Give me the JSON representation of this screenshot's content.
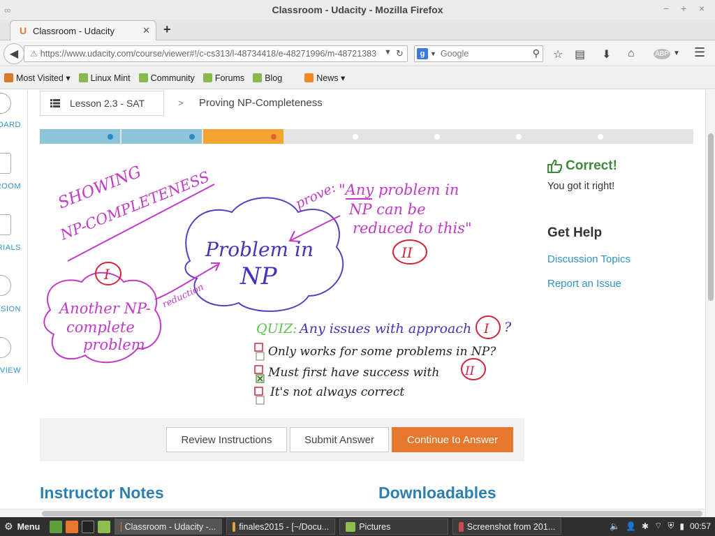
{
  "window": {
    "title": "Classroom - Udacity - Mozilla Firefox",
    "controls": [
      "−",
      "+",
      "×"
    ]
  },
  "tabs": [
    {
      "label": "Classroom - Udacity",
      "favicon": "U"
    }
  ],
  "navbar": {
    "url": "https://www.udacity.com/course/viewer#!/c-cs313/l-48734418/e-48271996/m-48721383",
    "url_host": "udacity.com",
    "search_placeholder": "Google"
  },
  "bookmarks": [
    {
      "label": "Most Visited ▾",
      "icon_color": "#d97a2b"
    },
    {
      "label": "Linux Mint",
      "icon_color": "#87b94d"
    },
    {
      "label": "Community",
      "icon_color": "#87b94d"
    },
    {
      "label": "Forums",
      "icon_color": "#87b94d"
    },
    {
      "label": "Blog",
      "icon_color": "#87b94d"
    },
    {
      "label": "News ▾",
      "icon_color": "#f08a24"
    }
  ],
  "sidenav": [
    "OARD",
    "ROOM",
    "RIALS",
    "SSION",
    "VIEW"
  ],
  "breadcrumb": {
    "lesson": "Lesson 2.3 - SAT",
    "separator": ">",
    "current": "Proving NP-Completeness"
  },
  "progress": {
    "segments": [
      {
        "color": "#8cc4da",
        "dot": "#2a8ac0"
      },
      {
        "color": "#8cc4da",
        "dot": "#2a8ac0"
      },
      {
        "color": "#f3a531",
        "dot": "#d9662a"
      },
      {
        "color": "#e4e4e4",
        "dot": "#ffffff"
      },
      {
        "color": "#e4e4e4",
        "dot": "#ffffff"
      },
      {
        "color": "#e4e4e4",
        "dot": "#ffffff"
      },
      {
        "color": "#e4e4e4",
        "dot": "#ffffff"
      },
      {
        "color": "#e4e4e4",
        "dot": null
      }
    ]
  },
  "sketch": {
    "heading_1": "SHOWING",
    "heading_2": "NP-COMPLETENESS",
    "center_1": "Problem in",
    "center_2": "NP",
    "left_1": "Another NP-",
    "left_2": "complete",
    "left_3": "problem",
    "arrow_label": "reduction",
    "prove_word": "prove:",
    "prove_1": "\"Any problem in",
    "prove_2": "NP can be",
    "prove_3": "reduced to this\"",
    "badge_1": "I",
    "badge_2": "II",
    "quiz_label": "QUIZ:",
    "quiz_question": "Any issues with approach",
    "quiz_mark": "?",
    "options": [
      {
        "text": "Only works for some problems in NP?",
        "checked": false
      },
      {
        "text": "Must first have success with",
        "checked": true
      },
      {
        "text": "It's not always correct",
        "checked": false
      }
    ]
  },
  "feedback": {
    "title": "Correct!",
    "subtitle": "You got it right!",
    "help_title": "Get Help",
    "links": [
      "Discussion Topics",
      "Report an Issue"
    ]
  },
  "actions": {
    "review": "Review Instructions",
    "submit": "Submit Answer",
    "continue": "Continue to Answer"
  },
  "sections": {
    "notes": "Instructor Notes",
    "downloads": "Downloadables"
  },
  "taskbar": {
    "menu": "Menu",
    "windows": [
      "Classroom - Udacity -...",
      "finales2015 - [~/Docu...",
      "Pictures",
      "Screenshot from 201..."
    ],
    "clock": "00:57"
  },
  "colors": {
    "accent": "#e8772e",
    "link": "#2f94c8",
    "correct": "#3c8a3a",
    "title_blue": "#2c7fb0"
  }
}
